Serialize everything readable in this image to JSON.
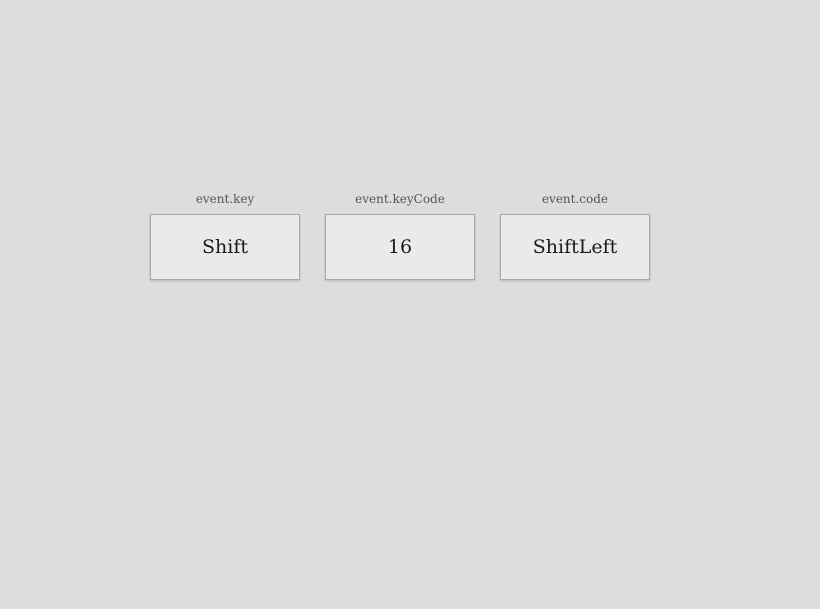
{
  "key_info": [
    {
      "label": "event.key",
      "value": "Shift"
    },
    {
      "label": "event.keyCode",
      "value": "16"
    },
    {
      "label": "event.code",
      "value": "ShiftLeft"
    }
  ]
}
